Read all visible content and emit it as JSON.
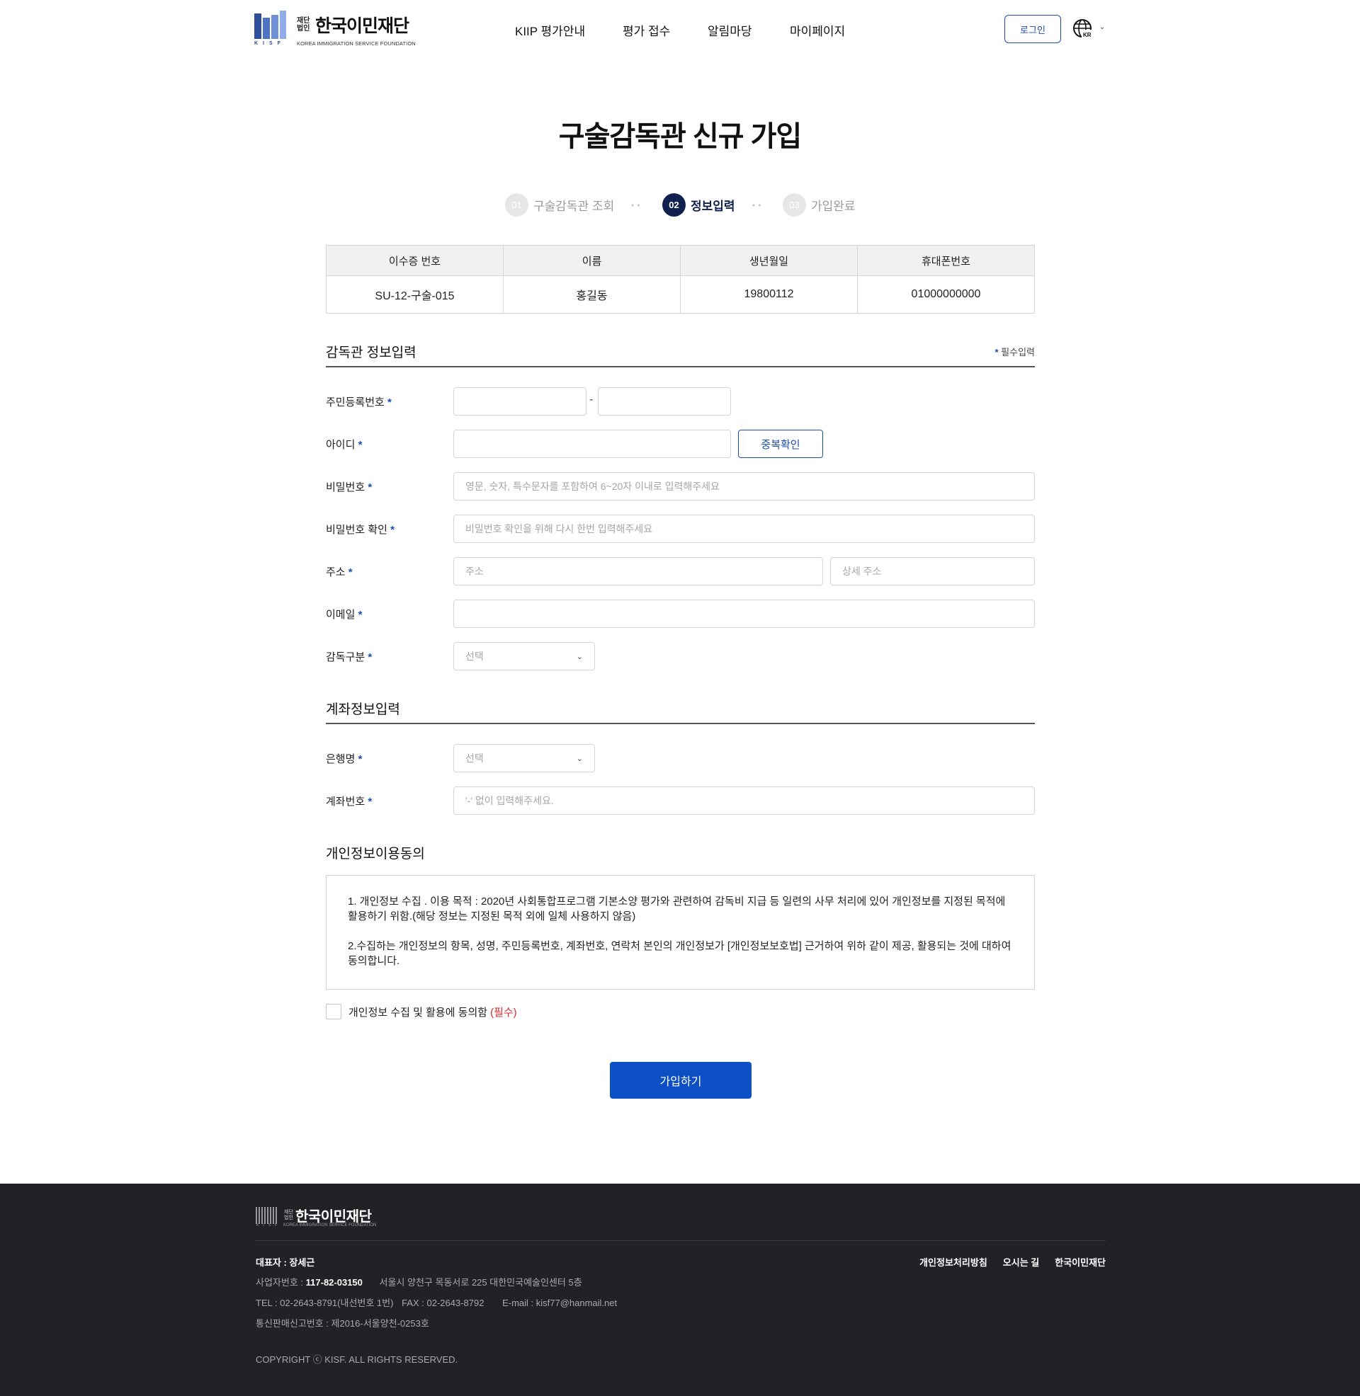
{
  "header": {
    "logo": {
      "small_text": "재단법인",
      "name": "한국이민재단",
      "sub": "KOREA IMMIGRATION SERVICE FOUNDATION",
      "mark_text": "KISF"
    },
    "nav": [
      "KIIP 평가안내",
      "평가 접수",
      "알림마당",
      "마이페이지"
    ],
    "login_label": "로그인",
    "lang_label": "KR"
  },
  "page_title": "구술감독관 신규 가입",
  "steps": [
    {
      "num": "01",
      "label": "구술감독관 조회",
      "active": false
    },
    {
      "num": "02",
      "label": "정보입력",
      "active": true
    },
    {
      "num": "03",
      "label": "가입완료",
      "active": false
    }
  ],
  "info_table": {
    "headers": [
      "이수증 번호",
      "이름",
      "생년월일",
      "휴대폰번호"
    ],
    "row": [
      "SU-12-구술-015",
      "홍길동",
      "19800112",
      "01000000000"
    ]
  },
  "supervisor_section": {
    "title": "감독관 정보입력",
    "required_note": "필수입력",
    "fields": {
      "rrn": {
        "label": "주민등록번호"
      },
      "id": {
        "label": "아이디",
        "dup_button": "중복확인"
      },
      "password": {
        "label": "비밀번호",
        "placeholder": "영문, 숫자, 특수문자를 포함하여 6~20자 이내로 입력해주세요"
      },
      "password_confirm": {
        "label": "비밀번호 확인",
        "placeholder": "비밀번호 확인을 위해 다시 한번 입력해주세요"
      },
      "address": {
        "label": "주소",
        "placeholder": "주소",
        "detail_placeholder": "상세 주소"
      },
      "email": {
        "label": "이메일"
      },
      "supervisor_type": {
        "label": "감독구분",
        "selected": "선택"
      }
    }
  },
  "account_section": {
    "title": "계좌정보입력",
    "fields": {
      "bank": {
        "label": "은행명",
        "selected": "선택"
      },
      "account_number": {
        "label": "계좌번호",
        "placeholder": "'-' 없이 입력해주세요."
      }
    }
  },
  "privacy": {
    "title": "개인정보이용동의",
    "paragraph1": "1. 개인정보 수집 . 이용 목적 : 2020년 사회통합프로그램 기본소양 평가와 관련하여 감독비 지급 등 일련의 사무 처리에 있어 개인정보를 지정된 목적에 활용하기 위함.(해당 정보는 지정된 목적 외에 일체 사용하지 않음)",
    "paragraph2": "2.수집하는 개인정보의 항목, 성명, 주민등록번호, 계좌번호, 연락처 본인의 개인정보가 [개인정보보호법] 근거하여 위하 같이 제공, 활용되는 것에 대하여 동의합니다.",
    "agree_label": "개인정보 수집 및 활용에 동의함",
    "agree_required": "(필수)"
  },
  "submit_label": "가입하기",
  "footer": {
    "logo_small": "재단법인",
    "logo_name": "한국이민재단",
    "logo_sub": "KOREA IMMIGRATION SERVICE FOUNDATION",
    "logo_mark_text": "KISF",
    "representative": "대표자 : 장세근",
    "biz_label": "사업자번호 : ",
    "biz_number": "117-82-03150",
    "address": "서울시 양천구 목동서로 225 대한민국예술인센터 5층",
    "tel": "TEL : 02-2643-8791(내선번호 1번)",
    "fax": "FAX : 02-2643-8792",
    "email": "E-mail : kisf77@hanmail.net",
    "mail_order": "통신판매신고번호 : 제2016-서울양천-0253호",
    "links": [
      "개인정보처리방침",
      "오시는 길",
      "한국이민재단"
    ],
    "copyright": "COPYRIGHT ⓒ KISF. ALL RIGHTS RESERVED."
  }
}
